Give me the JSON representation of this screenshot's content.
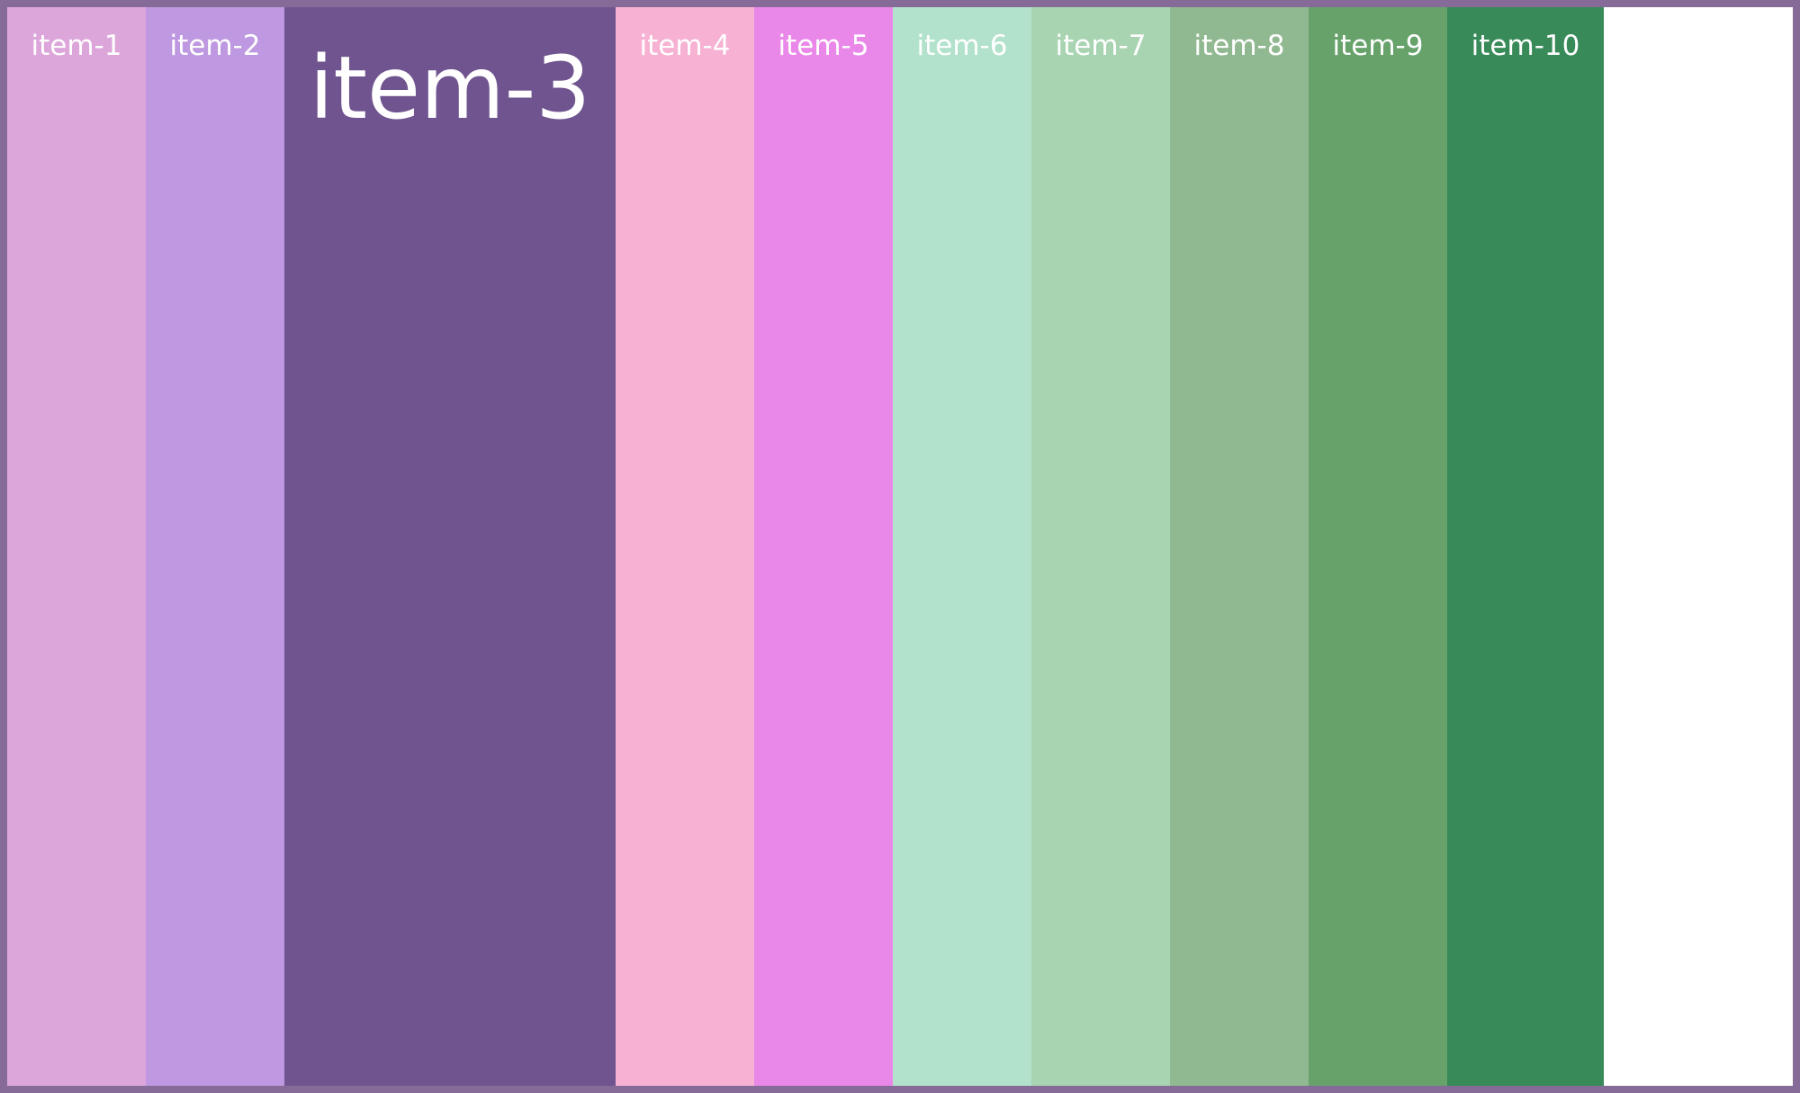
{
  "items": [
    {
      "label": "item-1",
      "color": "#dca6da"
    },
    {
      "label": "item-2",
      "color": "#be98e0"
    },
    {
      "label": "item-3",
      "color": "#70548f"
    },
    {
      "label": "item-4",
      "color": "#f6b1d3"
    },
    {
      "label": "item-5",
      "color": "#e988e8"
    },
    {
      "label": "item-6",
      "color": "#b2e2cc"
    },
    {
      "label": "item-7",
      "color": "#a8d4b1"
    },
    {
      "label": "item-8",
      "color": "#91b991"
    },
    {
      "label": "item-9",
      "color": "#66a26a"
    },
    {
      "label": "item-10",
      "color": "#388a59"
    }
  ],
  "frame_color": "#866b98"
}
